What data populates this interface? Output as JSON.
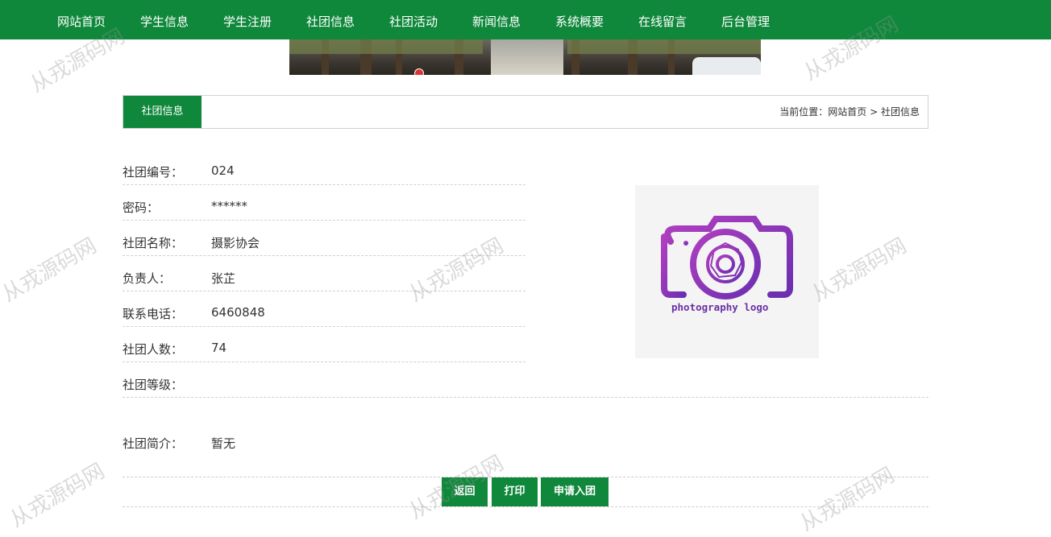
{
  "nav": {
    "items": [
      "网站首页",
      "学生信息",
      "学生注册",
      "社团信息",
      "社团活动",
      "新闻信息",
      "系统概要",
      "在线留言",
      "后台管理"
    ]
  },
  "section": {
    "title": "社团信息",
    "breadcrumb_prefix": "当前位置：",
    "breadcrumb_home": "网站首页",
    "breadcrumb_sep": ">",
    "breadcrumb_current": "社团信息"
  },
  "details": [
    {
      "label": "社团编号：",
      "value": "024"
    },
    {
      "label": "密码：",
      "value": "******"
    },
    {
      "label": "社团名称：",
      "value": "摄影协会"
    },
    {
      "label": "负责人：",
      "value": "张芷"
    },
    {
      "label": "联系电话：",
      "value": "6460848"
    },
    {
      "label": "社团人数：",
      "value": "74"
    },
    {
      "label": "社团等级：",
      "value": ""
    },
    {
      "label": "社团简介：",
      "value": "暂无"
    }
  ],
  "photo": {
    "caption": "photography logo"
  },
  "buttons": {
    "back": "返回",
    "print": "打印",
    "join": "申请入团"
  },
  "watermark": "从戎源码网",
  "colors": {
    "primary": "#0f883b",
    "logo": "#8a3bbd"
  }
}
